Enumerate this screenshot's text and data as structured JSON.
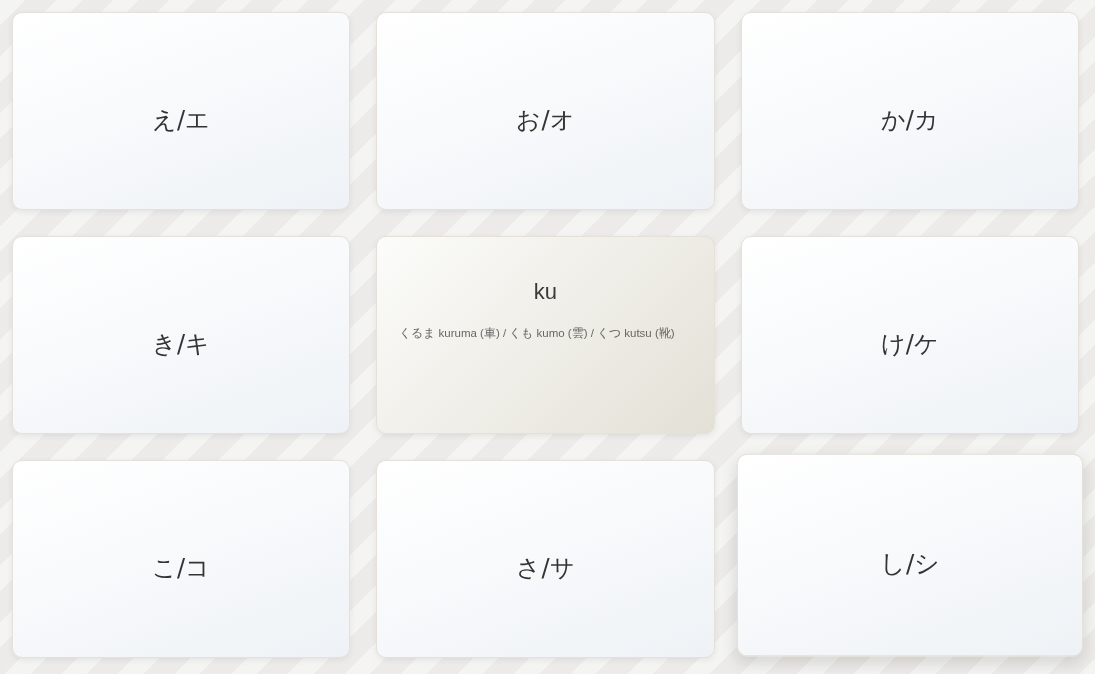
{
  "cards": [
    {
      "flipped": false,
      "hovered": false,
      "kana": "え/エ"
    },
    {
      "flipped": false,
      "hovered": false,
      "kana": "お/オ"
    },
    {
      "flipped": false,
      "hovered": false,
      "kana": "か/カ"
    },
    {
      "flipped": false,
      "hovered": false,
      "kana": "き/キ"
    },
    {
      "flipped": true,
      "hovered": false,
      "romaji": "ku",
      "examples": "くるま kuruma (車) / くも kumo (雲) / くつ kutsu (靴)"
    },
    {
      "flipped": false,
      "hovered": false,
      "kana": "け/ケ"
    },
    {
      "flipped": false,
      "hovered": false,
      "kana": "こ/コ"
    },
    {
      "flipped": false,
      "hovered": false,
      "kana": "さ/サ"
    },
    {
      "flipped": false,
      "hovered": true,
      "kana": "し/シ"
    }
  ]
}
